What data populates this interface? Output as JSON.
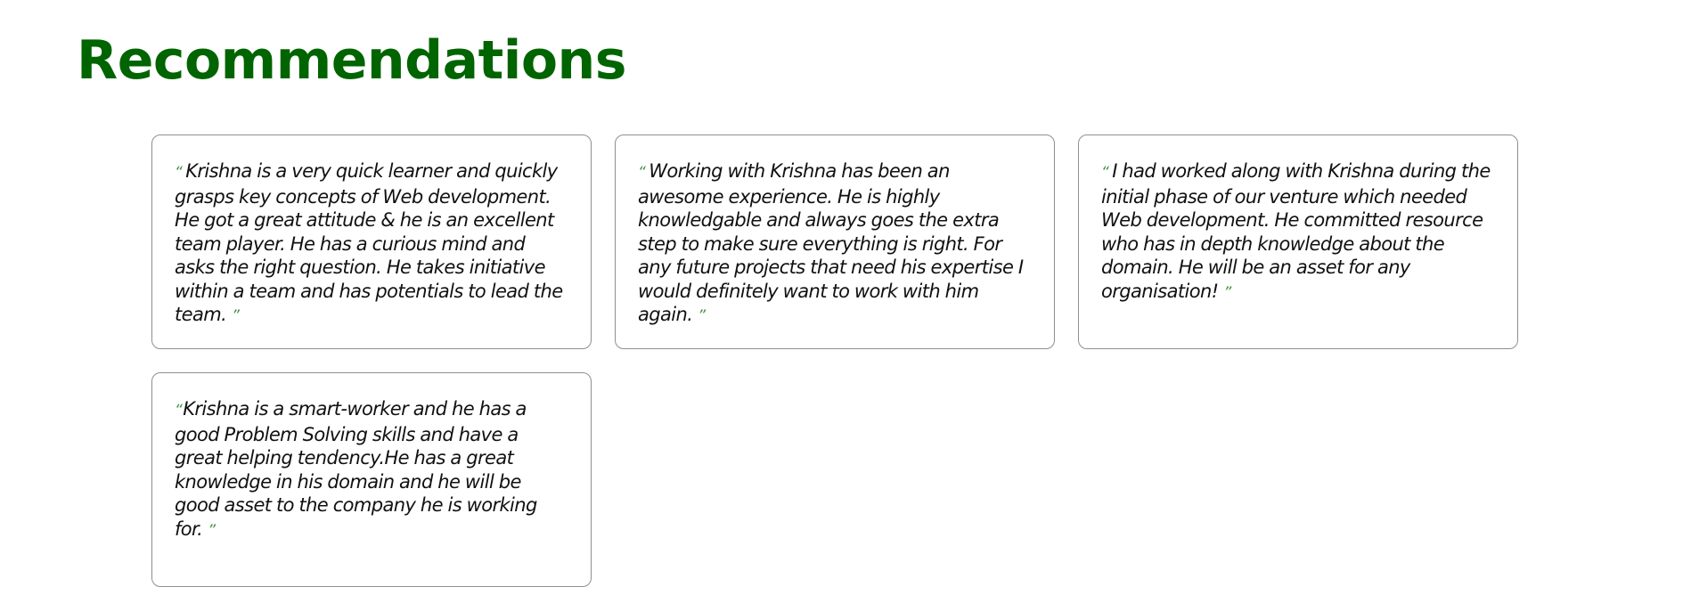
{
  "page": {
    "title": "Recommendations"
  },
  "recommendations": [
    {
      "open_quote": "“",
      "text": "Krishna is a very quick learner and quickly grasps key concepts of Web development. He got a great attitude & he is an excellent team player. He has a curious mind and asks the right question. He takes initiative within a team and has potentials to lead the team.",
      "close_quote": "”"
    },
    {
      "open_quote": "“",
      "text": "Working with Krishna has been an awesome experience. He is highly knowledgable and always goes the extra step to make sure everything is right. For any future projects that need his expertise I would definitely want to work with him again.",
      "close_quote": "”"
    },
    {
      "open_quote": "“",
      "text": "I had worked along with Krishna during the initial phase of our venture which needed Web development. He committed resource who has in depth knowledge about the domain. He will be an asset for any organisation!",
      "close_quote": "”"
    },
    {
      "open_quote": "“",
      "text": "Krishna is a smart-worker and he has a good Problem Solving skills and have a great helping tendency.He has a great knowledge in his domain and he will be good asset to the company he is working for.",
      "close_quote": "”"
    }
  ],
  "colors": {
    "title": "#006400",
    "quote_mark": "#3f8f3f",
    "card_border": "#8f8f8f",
    "text": "#111111"
  }
}
